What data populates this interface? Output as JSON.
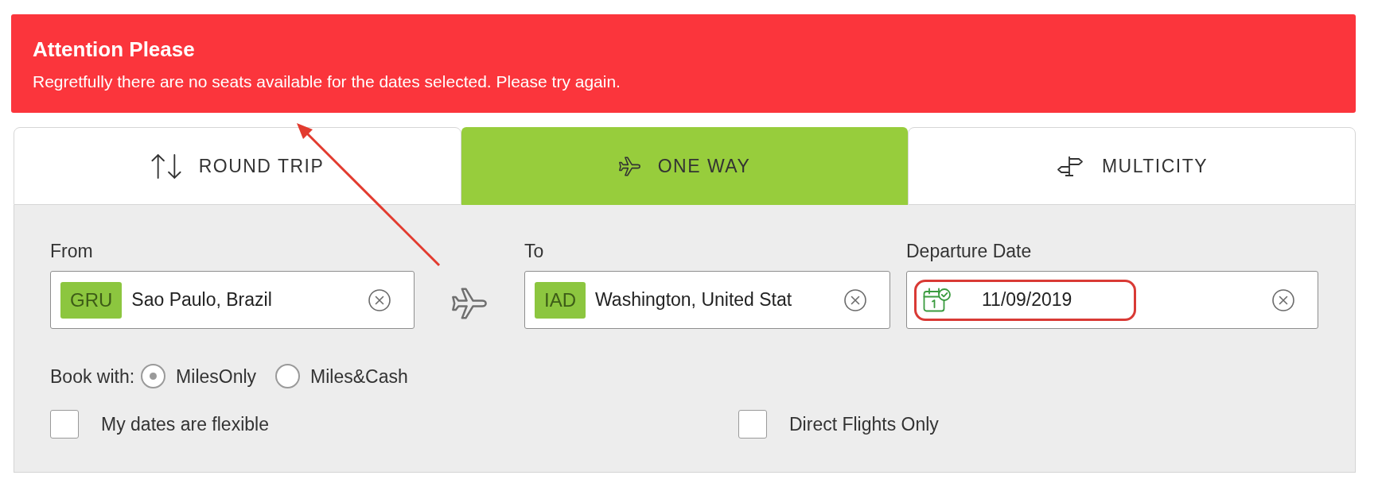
{
  "alert": {
    "title": "Attention Please",
    "message": "Regretfully there are no seats available for the dates selected. Please try again."
  },
  "tabs": [
    {
      "kind": "round_trip",
      "label": "ROUND TRIP",
      "selected": false
    },
    {
      "kind": "one_way",
      "label": "ONE WAY",
      "selected": true
    },
    {
      "kind": "multicity",
      "label": "MULTICITY",
      "selected": false
    }
  ],
  "search": {
    "from": {
      "label": "From",
      "code": "GRU",
      "value": "Sao Paulo, Brazil"
    },
    "to": {
      "label": "To",
      "code": "IAD",
      "value": "Washington, United Stat"
    },
    "departure_date": {
      "label": "Departure Date",
      "value": "11/09/2019",
      "highlighted": true
    }
  },
  "book_with": {
    "label": "Book with:",
    "options": [
      {
        "label": "MilesOnly",
        "selected": true
      },
      {
        "label": "Miles&Cash",
        "selected": false
      }
    ]
  },
  "options": [
    {
      "label": "My dates are flexible",
      "checked": false
    },
    {
      "label": "Direct Flights Only",
      "checked": false
    }
  ],
  "annotations": [
    {
      "kind": "arrow"
    }
  ]
}
